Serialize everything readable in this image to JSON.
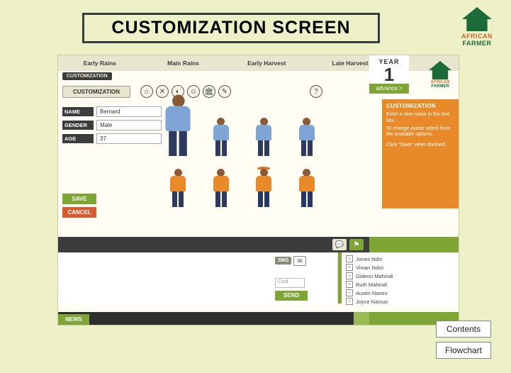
{
  "slide": {
    "title": "CUSTOMIZATION SCREEN",
    "logo": {
      "line1": "AFRICAN",
      "line2": "FARMER"
    }
  },
  "game": {
    "seasons": [
      "Early Rains",
      "Main Rains",
      "Early Harvest",
      "Late Harvest"
    ],
    "year_label": "YEAR",
    "year_value": "1",
    "advance_label": "advance >",
    "tab_small": "CUSTOMIZATION",
    "tab_big": "CUSTOMIZATION",
    "toolbar_icons": [
      "home",
      "tools",
      "globe",
      "people",
      "bank",
      "notes"
    ],
    "help_icon": "?",
    "form": {
      "name_label": "NAME",
      "name_value": "Bernard",
      "gender_label": "GENDER",
      "gender_value": "Male",
      "age_label": "AGE",
      "age_value": "37",
      "save": "SAVE",
      "cancel": "CANCEL"
    },
    "help": {
      "title": "CUSTOMIZATION",
      "line1": "Enter a new name in the text box.",
      "line2": "To change avatar select from the available options.",
      "line3": "Click \"Save\" when finished."
    },
    "chat": {
      "sms": "SMS",
      "cost_placeholder": "Cost",
      "send": "SEND"
    },
    "players": [
      "Jones Ndiri",
      "Vivian Ndizi",
      "Gideon Mahindi",
      "Ruth Mahindi",
      "Austin Nanes",
      "Joyce Nansai"
    ],
    "news_label": "NEWS"
  },
  "nav": {
    "contents": "Contents",
    "flowchart": "Flowchart"
  }
}
